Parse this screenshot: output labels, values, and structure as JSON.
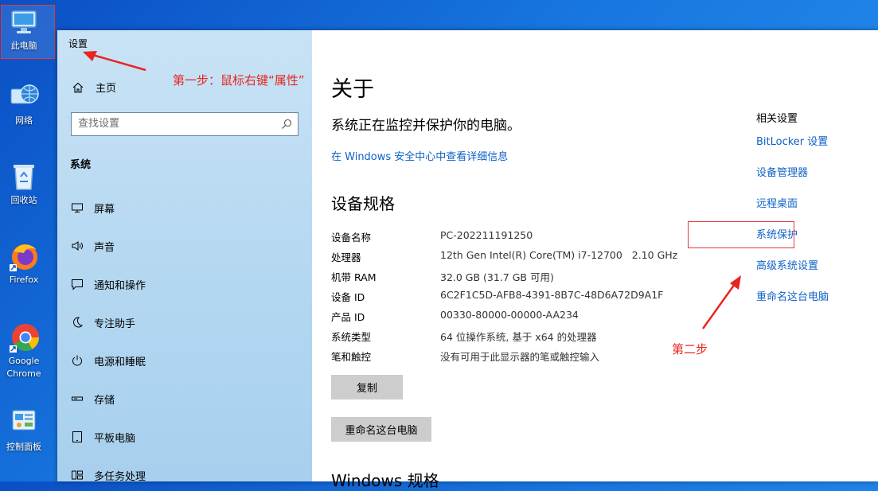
{
  "desktop": {
    "icons": [
      {
        "label": "此电脑",
        "icon": "computer-icon"
      },
      {
        "label": "网络",
        "icon": "network-globe-icon"
      },
      {
        "label": "回收站",
        "icon": "recycle-bin-icon"
      },
      {
        "label": "Firefox",
        "icon": "firefox-icon"
      },
      {
        "label": "Google Chrome",
        "icon": "chrome-icon"
      },
      {
        "label": "控制面板",
        "icon": "control-panel-icon"
      }
    ]
  },
  "window": {
    "title": "设置"
  },
  "sidebar": {
    "home_label": "主页",
    "search_placeholder": "查找设置",
    "section_label": "系统",
    "items": [
      {
        "label": "屏幕",
        "icon": "display-icon"
      },
      {
        "label": "声音",
        "icon": "speaker-icon"
      },
      {
        "label": "通知和操作",
        "icon": "notification-icon"
      },
      {
        "label": "专注助手",
        "icon": "moon-icon"
      },
      {
        "label": "电源和睡眠",
        "icon": "power-icon"
      },
      {
        "label": "存储",
        "icon": "storage-icon"
      },
      {
        "label": "平板电脑",
        "icon": "tablet-icon"
      },
      {
        "label": "多任务处理",
        "icon": "multitasking-icon"
      }
    ]
  },
  "about": {
    "title": "关于",
    "status": "系统正在监控并保护你的电脑。",
    "security_link": "在 Windows 安全中心中查看详细信息",
    "specs_title": "设备规格",
    "specs": [
      {
        "key": "设备名称",
        "value": "PC-202211191250"
      },
      {
        "key": "处理器",
        "value": "12th Gen Intel(R) Core(TM) i7-12700   2.10 GHz"
      },
      {
        "key": "机带 RAM",
        "value": "32.0 GB (31.7 GB 可用)"
      },
      {
        "key": "设备 ID",
        "value": "6C2F1C5D-AFB8-4391-8B7C-48D6A72D9A1F"
      },
      {
        "key": "产品 ID",
        "value": "00330-80000-00000-AA234"
      },
      {
        "key": "系统类型",
        "value": "64 位操作系统, 基于 x64 的处理器"
      },
      {
        "key": "笔和触控",
        "value": "没有可用于此显示器的笔或触控输入"
      }
    ],
    "copy_button": "复制",
    "rename_button": "重命名这台电脑",
    "windows_specs_title": "Windows 规格"
  },
  "related": {
    "title": "相关设置",
    "links": [
      "BitLocker 设置",
      "设备管理器",
      "远程桌面",
      "系统保护",
      "高级系统设置",
      "重命名这台电脑"
    ]
  },
  "annotations": {
    "step1": "第一步：鼠标右键“属性”",
    "step2": "第二步"
  },
  "colors": {
    "annotation": "#e8251f",
    "link": "#0f62c7",
    "sidebar_bg": "#b9daf2"
  }
}
